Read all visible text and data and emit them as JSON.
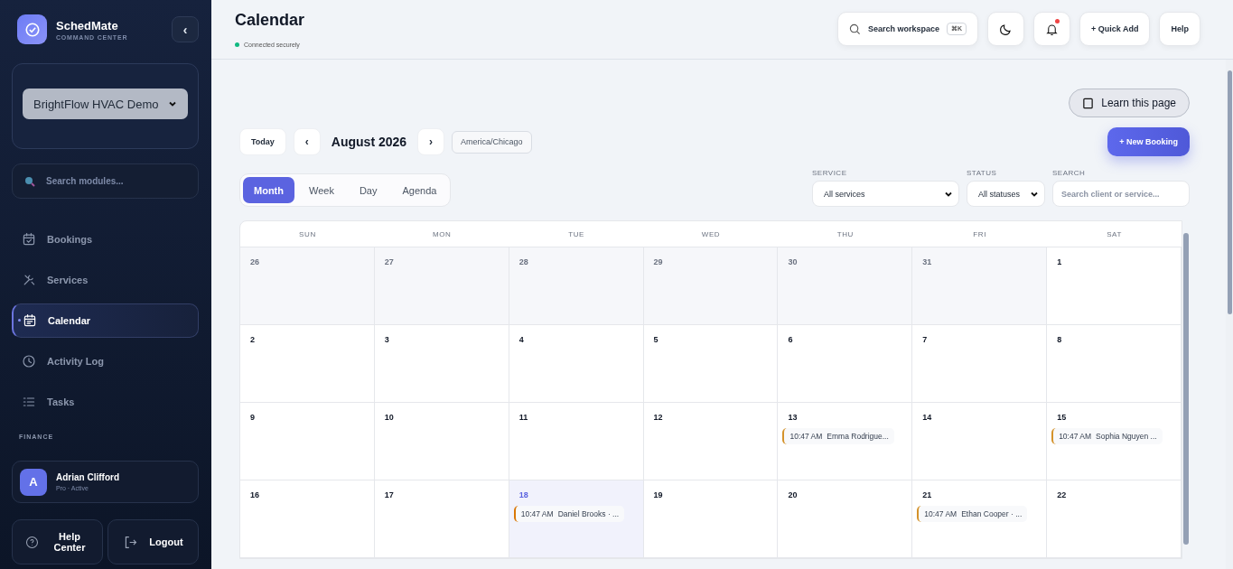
{
  "sidebar": {
    "brand": {
      "name": "SchedMate",
      "tagline": "COMMAND CENTER"
    },
    "collapse_button": "‹",
    "workspace": {
      "value": "BrightFlow HVAC Demo"
    },
    "search": {
      "placeholder": "Search modules..."
    },
    "nav": [
      {
        "label": "Bookings",
        "selected": false
      },
      {
        "label": "Services",
        "selected": false
      },
      {
        "label": "Calendar",
        "selected": true
      },
      {
        "label": "Activity Log",
        "selected": false
      },
      {
        "label": "Tasks",
        "selected": false
      }
    ],
    "section_label": "FINANCE",
    "user": {
      "initial": "A",
      "name": "Adrian Clifford",
      "plan": "Pro · Active"
    },
    "help_button": "Help Center",
    "logout_button": "Logout"
  },
  "header": {
    "title": "Calendar",
    "status": "Connected securely",
    "search": {
      "label": "Search workspace",
      "shortcut": "⌘K"
    },
    "notifications_unread": true,
    "quick_add": "+ Quick Add",
    "help": "Help"
  },
  "learn_button": "Learn this page",
  "toolbar": {
    "today": "Today",
    "prev": "‹",
    "month": "August 2026",
    "next": "›",
    "timezone": "America/Chicago",
    "new_booking": "+ New Booking"
  },
  "views": [
    {
      "label": "Month",
      "selected": true
    },
    {
      "label": "Week",
      "selected": false
    },
    {
      "label": "Day",
      "selected": false
    },
    {
      "label": "Agenda",
      "selected": false
    }
  ],
  "filters": {
    "service": {
      "label": "SERVICE",
      "value": "All services"
    },
    "status": {
      "label": "STATUS",
      "value": "All statuses"
    },
    "search": {
      "label": "SEARCH",
      "placeholder": "Search client or service..."
    }
  },
  "calendar": {
    "weekdays": [
      "SUN",
      "MON",
      "TUE",
      "WED",
      "THU",
      "FRI",
      "SAT"
    ],
    "weeks": [
      [
        {
          "day": "26",
          "outside": true,
          "today": false
        },
        {
          "day": "27",
          "outside": true,
          "today": false
        },
        {
          "day": "28",
          "outside": true,
          "today": false
        },
        {
          "day": "29",
          "outside": true,
          "today": false
        },
        {
          "day": "30",
          "outside": true,
          "today": false
        },
        {
          "day": "31",
          "outside": true,
          "today": false
        },
        {
          "day": "1",
          "outside": false,
          "today": false
        }
      ],
      [
        {
          "day": "2",
          "outside": false,
          "today": false
        },
        {
          "day": "3",
          "outside": false,
          "today": false
        },
        {
          "day": "4",
          "outside": false,
          "today": false
        },
        {
          "day": "5",
          "outside": false,
          "today": false
        },
        {
          "day": "6",
          "outside": false,
          "today": false
        },
        {
          "day": "7",
          "outside": false,
          "today": false
        },
        {
          "day": "8",
          "outside": false,
          "today": false
        }
      ],
      [
        {
          "day": "9",
          "outside": false,
          "today": false
        },
        {
          "day": "10",
          "outside": false,
          "today": false
        },
        {
          "day": "11",
          "outside": false,
          "today": false
        },
        {
          "day": "12",
          "outside": false,
          "today": false
        },
        {
          "day": "13",
          "outside": false,
          "today": false,
          "events": [
            {
              "time": "10:47 AM",
              "title": "Emma Rodrigue...",
              "color": "#d4922a"
            }
          ]
        },
        {
          "day": "14",
          "outside": false,
          "today": false
        },
        {
          "day": "15",
          "outside": false,
          "today": false,
          "events": [
            {
              "time": "10:47 AM",
              "title": "Sophia Nguyen ...",
              "color": "#d4922a"
            }
          ]
        }
      ],
      [
        {
          "day": "16",
          "outside": false,
          "today": false
        },
        {
          "day": "17",
          "outside": false,
          "today": false
        },
        {
          "day": "18",
          "outside": false,
          "today": true,
          "events": [
            {
              "time": "10:47 AM",
              "title": "Daniel Brooks · ...",
              "color": "#d97706"
            }
          ]
        },
        {
          "day": "19",
          "outside": false,
          "today": false
        },
        {
          "day": "20",
          "outside": false,
          "today": false
        },
        {
          "day": "21",
          "outside": false,
          "today": false,
          "events": [
            {
              "time": "10:47 AM",
              "title": "Ethan Cooper · ...",
              "color": "#d4922a"
            }
          ]
        },
        {
          "day": "22",
          "outside": false,
          "today": false
        }
      ]
    ]
  }
}
